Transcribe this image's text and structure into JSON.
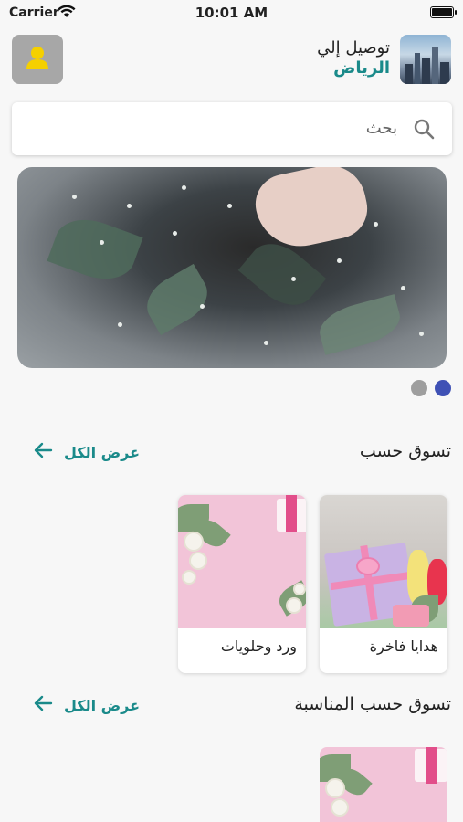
{
  "status_bar": {
    "carrier": "Carrier",
    "time": "10:01 AM"
  },
  "header": {
    "deliver_label": "توصيل إلي",
    "city": "الرياض",
    "city_thumb_icon": "city-skyline-image",
    "profile_icon": "user-icon"
  },
  "search": {
    "placeholder": "بحث",
    "icon": "search-icon"
  },
  "banner": {
    "image": "flower-bouquet-photo",
    "pages": 2,
    "active_page": 1
  },
  "sections": [
    {
      "title": "تسوق حسب",
      "see_all": "عرض الكل",
      "items": [
        {
          "label": "هدايا فاخرة",
          "image": "gift-box-with-flowers"
        },
        {
          "label": "ورد وحلويات",
          "image": "flowers-on-pink"
        }
      ]
    },
    {
      "title": "تسوق حسب المناسبة",
      "see_all": "عرض الكل",
      "items": [
        {
          "label": "",
          "image": "flowers-on-pink"
        }
      ]
    }
  ],
  "colors": {
    "accent": "#1a8a8a",
    "dot_active": "#3f51b5",
    "dot_inactive": "#9e9e9e",
    "avatar_bg": "#a7a7a7",
    "avatar_icon": "#f5d000",
    "background": "#f7f7f7"
  }
}
